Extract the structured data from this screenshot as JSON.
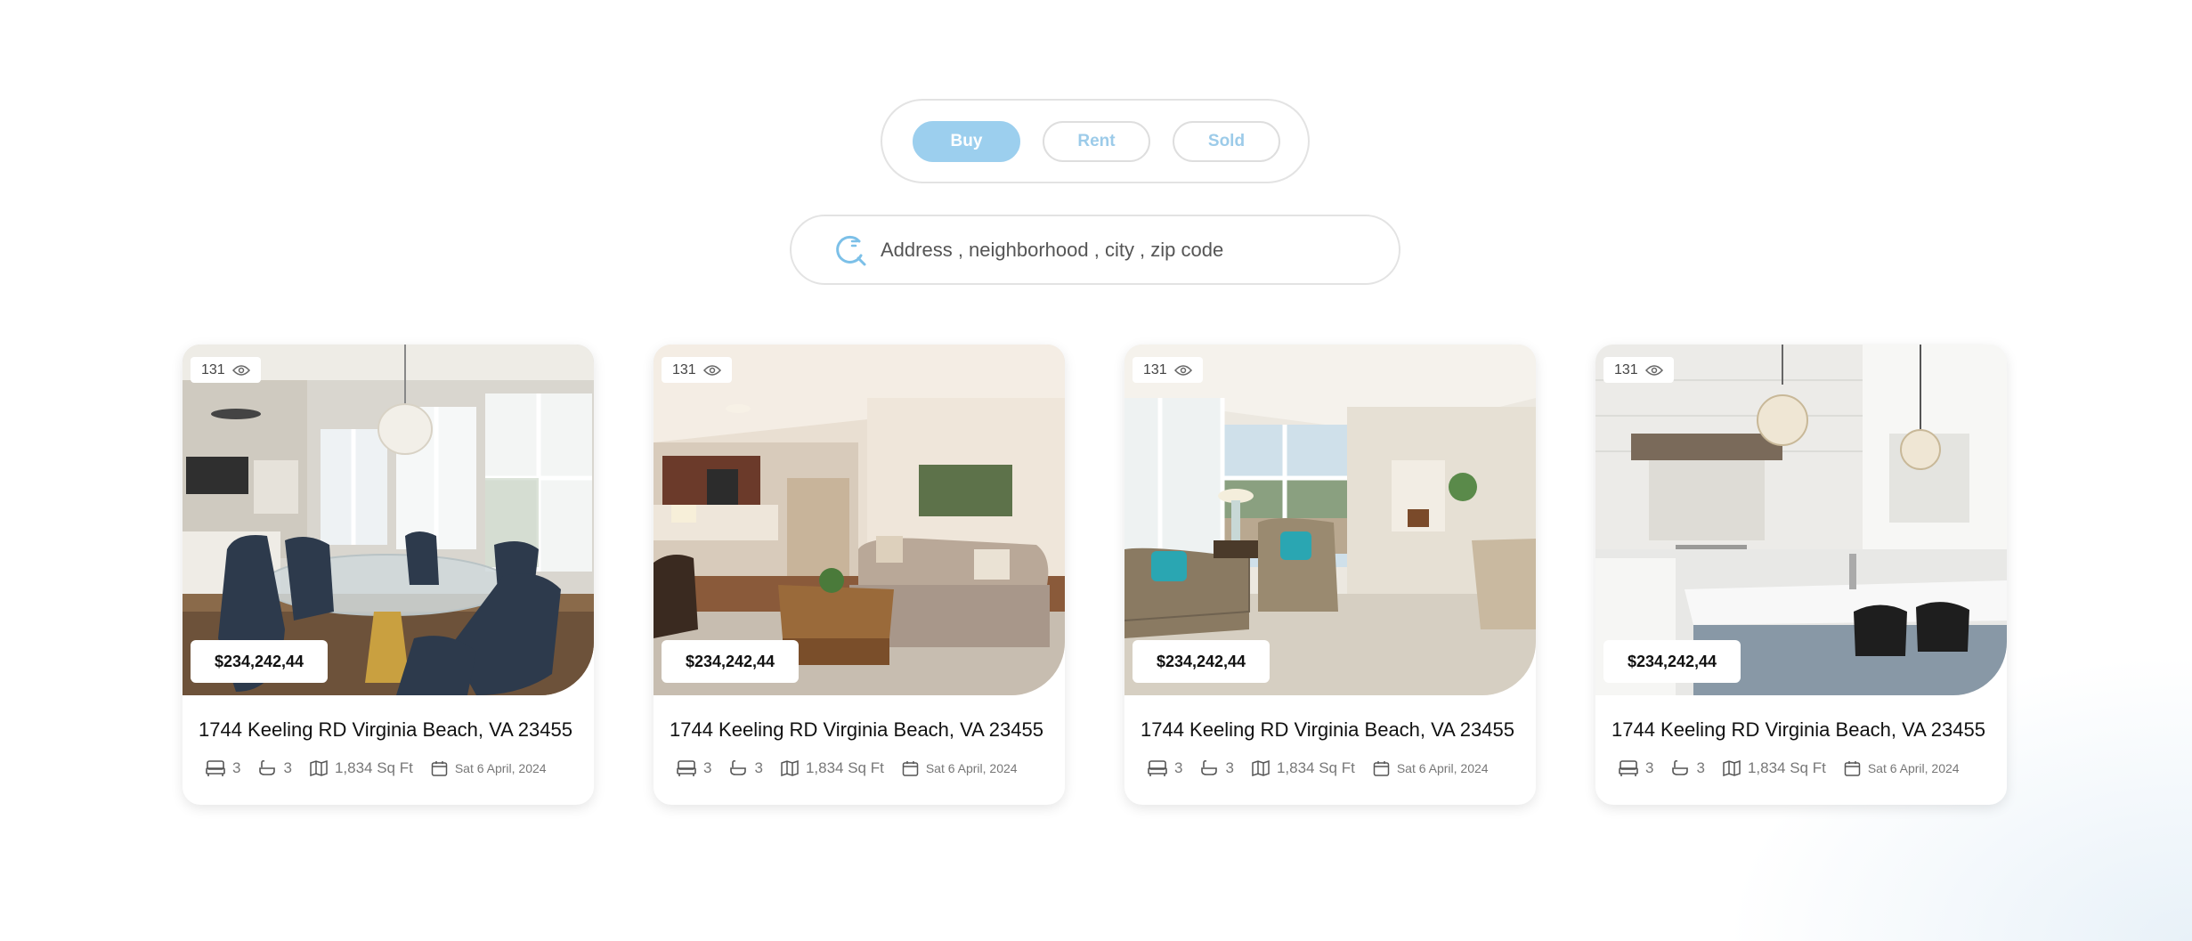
{
  "tabs": [
    {
      "label": "Buy",
      "active": true
    },
    {
      "label": "Rent",
      "active": false
    },
    {
      "label": "Sold",
      "active": false
    }
  ],
  "search": {
    "placeholder": "Address , neighborhood , city , zip code",
    "icon": "search-icon"
  },
  "colors": {
    "accent": "#9ccfee",
    "accent_text": "#9ccbe9"
  },
  "listings": [
    {
      "views": "131",
      "price": "$234,242,44",
      "address": "1744 Keeling RD Virginia Beach, VA 23455",
      "beds": "3",
      "baths": "3",
      "area": "1,834 Sq Ft",
      "date": "Sat 6 April, 2024",
      "photo": "dining room"
    },
    {
      "views": "131",
      "price": "$234,242,44",
      "address": "1744 Keeling RD Virginia Beach, VA 23455",
      "beds": "3",
      "baths": "3",
      "area": "1,834 Sq Ft",
      "date": "Sat 6 April, 2024",
      "photo": "living room"
    },
    {
      "views": "131",
      "price": "$234,242,44",
      "address": "1744 Keeling RD Virginia Beach, VA 23455",
      "beds": "3",
      "baths": "3",
      "area": "1,834 Sq Ft",
      "date": "Sat 6 April, 2024",
      "photo": "sunroom lounge"
    },
    {
      "views": "131",
      "price": "$234,242,44",
      "address": "1744 Keeling RD Virginia Beach, VA 23455",
      "beds": "3",
      "baths": "3",
      "area": "1,834 Sq Ft",
      "date": "Sat 6 April, 2024",
      "photo": "kitchen"
    }
  ]
}
